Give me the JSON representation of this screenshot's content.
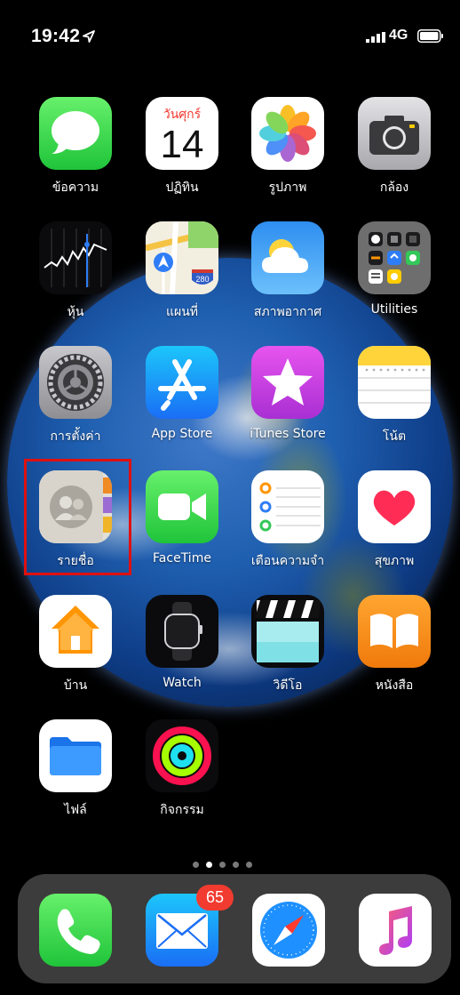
{
  "status_bar": {
    "time": "19:42",
    "network": "4G",
    "icons": [
      "location-arrow-icon",
      "signal-bars-icon",
      "battery-icon"
    ]
  },
  "calendar": {
    "weekday": "วันศุกร์",
    "day": "14"
  },
  "maps": {
    "shield": "280"
  },
  "apps": [
    {
      "name": "messages",
      "label": "ข้อความ"
    },
    {
      "name": "calendar",
      "label": "ปฏิทิน"
    },
    {
      "name": "photos",
      "label": "รูปภาพ"
    },
    {
      "name": "camera",
      "label": "กล้อง"
    },
    {
      "name": "stocks",
      "label": "หุ้น"
    },
    {
      "name": "maps",
      "label": "แผนที่"
    },
    {
      "name": "weather",
      "label": "สภาพอากาศ"
    },
    {
      "name": "utilities",
      "label": "Utilities"
    },
    {
      "name": "settings",
      "label": "การตั้งค่า"
    },
    {
      "name": "app-store",
      "label": "App Store"
    },
    {
      "name": "itunes-store",
      "label": "iTunes Store"
    },
    {
      "name": "notes",
      "label": "โน้ต"
    },
    {
      "name": "contacts",
      "label": "รายชื่อ"
    },
    {
      "name": "facetime",
      "label": "FaceTime"
    },
    {
      "name": "reminders",
      "label": "เตือนความจำ"
    },
    {
      "name": "health",
      "label": "สุขภาพ"
    },
    {
      "name": "home",
      "label": "บ้าน"
    },
    {
      "name": "watch",
      "label": "Watch"
    },
    {
      "name": "clips",
      "label": "วิดีโอ"
    },
    {
      "name": "books",
      "label": "หนังสือ"
    },
    {
      "name": "files",
      "label": "ไฟล์"
    },
    {
      "name": "activity",
      "label": "กิจกรรม"
    }
  ],
  "page_dots": {
    "count": 5,
    "active_index": 1
  },
  "dock": {
    "apps": [
      "phone",
      "mail",
      "safari",
      "music"
    ],
    "mail_badge": "65"
  },
  "highlight": {
    "target": "contacts",
    "color": "#e01010"
  }
}
